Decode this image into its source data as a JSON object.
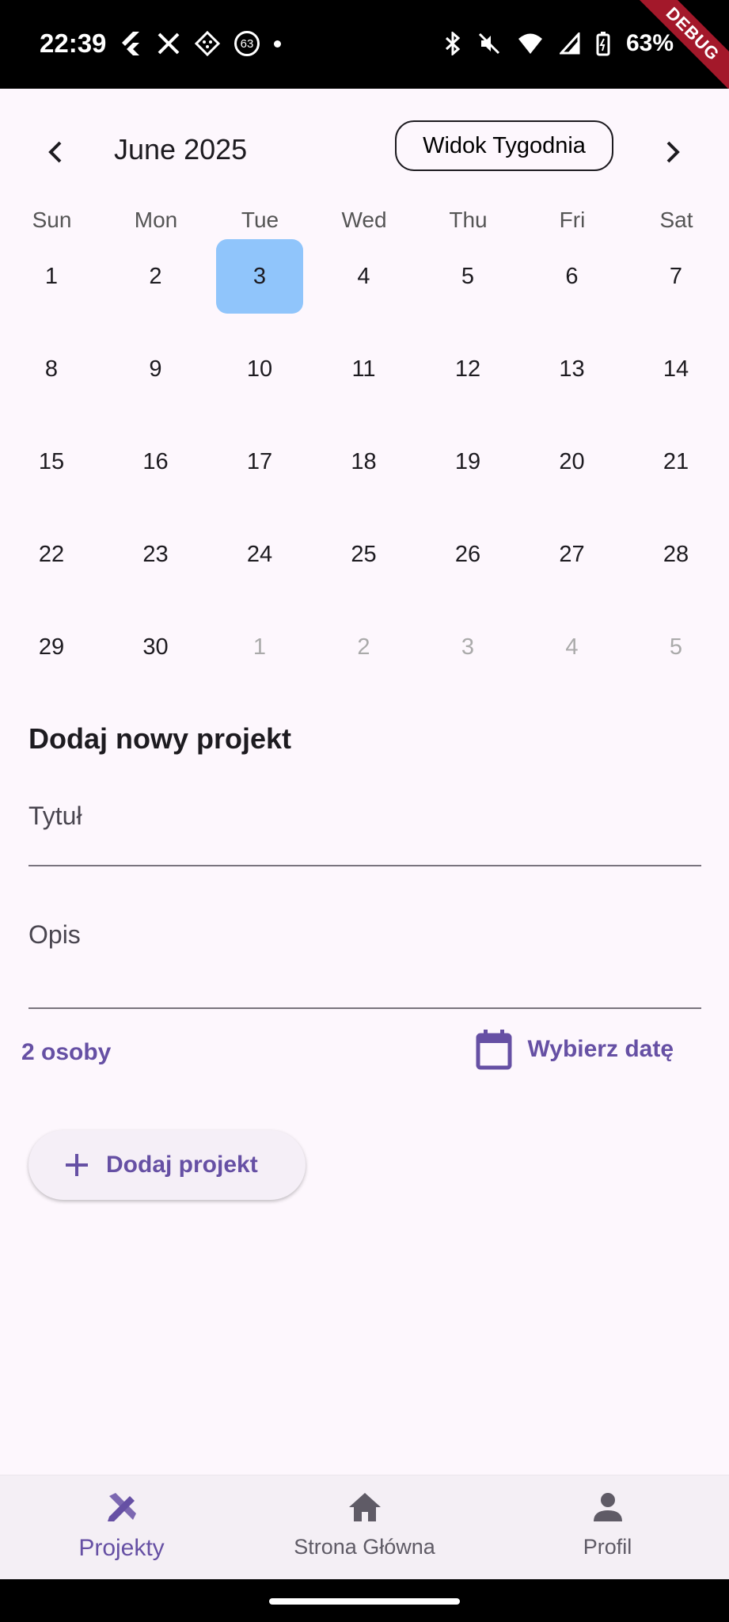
{
  "status_bar": {
    "time": "22:39",
    "notification_count": "63",
    "battery": "63%",
    "debug_label": "DEBUG"
  },
  "calendar": {
    "month_title": "June 2025",
    "week_view_label": "Widok Tygodnia",
    "weekdays": [
      "Sun",
      "Mon",
      "Tue",
      "Wed",
      "Thu",
      "Fri",
      "Sat"
    ],
    "weeks": [
      [
        {
          "d": "1"
        },
        {
          "d": "2"
        },
        {
          "d": "3",
          "selected": true
        },
        {
          "d": "4"
        },
        {
          "d": "5"
        },
        {
          "d": "6"
        },
        {
          "d": "7"
        }
      ],
      [
        {
          "d": "8"
        },
        {
          "d": "9"
        },
        {
          "d": "10"
        },
        {
          "d": "11"
        },
        {
          "d": "12"
        },
        {
          "d": "13"
        },
        {
          "d": "14"
        }
      ],
      [
        {
          "d": "15"
        },
        {
          "d": "16"
        },
        {
          "d": "17"
        },
        {
          "d": "18"
        },
        {
          "d": "19"
        },
        {
          "d": "20"
        },
        {
          "d": "21"
        }
      ],
      [
        {
          "d": "22"
        },
        {
          "d": "23"
        },
        {
          "d": "24"
        },
        {
          "d": "25"
        },
        {
          "d": "26"
        },
        {
          "d": "27"
        },
        {
          "d": "28"
        }
      ],
      [
        {
          "d": "29"
        },
        {
          "d": "30"
        },
        {
          "d": "1",
          "outside": true
        },
        {
          "d": "2",
          "outside": true
        },
        {
          "d": "3",
          "outside": true
        },
        {
          "d": "4",
          "outside": true
        },
        {
          "d": "5",
          "outside": true
        }
      ]
    ]
  },
  "form": {
    "title": "Dodaj nowy projekt",
    "title_field_label": "Tytuł",
    "description_field_label": "Opis",
    "people_label": "2 osoby",
    "pick_date_label": "Wybierz datę",
    "add_project_label": "Dodaj projekt"
  },
  "colors": {
    "accent": "#6650a4",
    "selected_day": "#90c5fb",
    "background": "#fdf7fd"
  },
  "bottom_nav": {
    "items": [
      {
        "label": "Projekty",
        "icon": "projects-icon",
        "active": true
      },
      {
        "label": "Strona Główna",
        "icon": "home-icon",
        "active": false
      },
      {
        "label": "Profil",
        "icon": "person-icon",
        "active": false
      }
    ]
  }
}
